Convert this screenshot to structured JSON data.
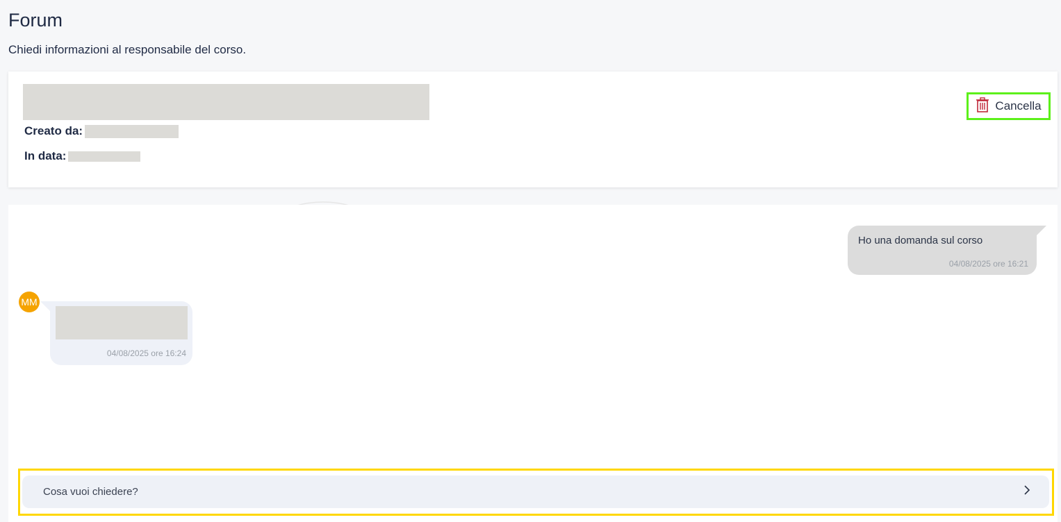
{
  "page": {
    "title": "Forum",
    "subtitle": "Chiedi informazioni al responsabile del corso."
  },
  "topic": {
    "created_by_label": "Creato da:",
    "date_label": "In data:",
    "delete_label": "Cancella",
    "delete_icon": "trash-icon"
  },
  "messages": [
    {
      "direction": "outgoing",
      "text": "Ho una domanda sul corso",
      "time": "04/08/2025 ore 16:21"
    },
    {
      "direction": "incoming",
      "avatar_initials": "MM",
      "avatar_color": "#f5a300",
      "time": "04/08/2025 ore 16:24"
    }
  ],
  "composer": {
    "placeholder": "Cosa vuoi chiedere?",
    "send_icon": "chevron-right-icon"
  },
  "colors": {
    "highlight_delete": "#5cf01a",
    "highlight_composer": "#ffd700",
    "trash_icon": "#c0283a"
  }
}
